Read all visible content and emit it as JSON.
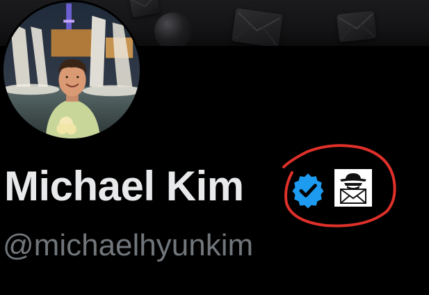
{
  "profile": {
    "display_name": "Michael Kim",
    "handle": "@michaelhyunkim",
    "avatar_icon": "profile-photo",
    "verified_icon": "verified-badge-icon",
    "affiliate_icon": "spy-envelope-icon"
  },
  "banner": {
    "icons": [
      "sphere",
      "envelope-icon",
      "envelope-icon"
    ]
  },
  "annotation": {
    "color": "#e0302a",
    "shape": "hand-drawn circle"
  },
  "colors": {
    "background": "#000000",
    "name": "#e7e9ea",
    "handle": "#71767b",
    "verified": "#1d9bf0"
  }
}
